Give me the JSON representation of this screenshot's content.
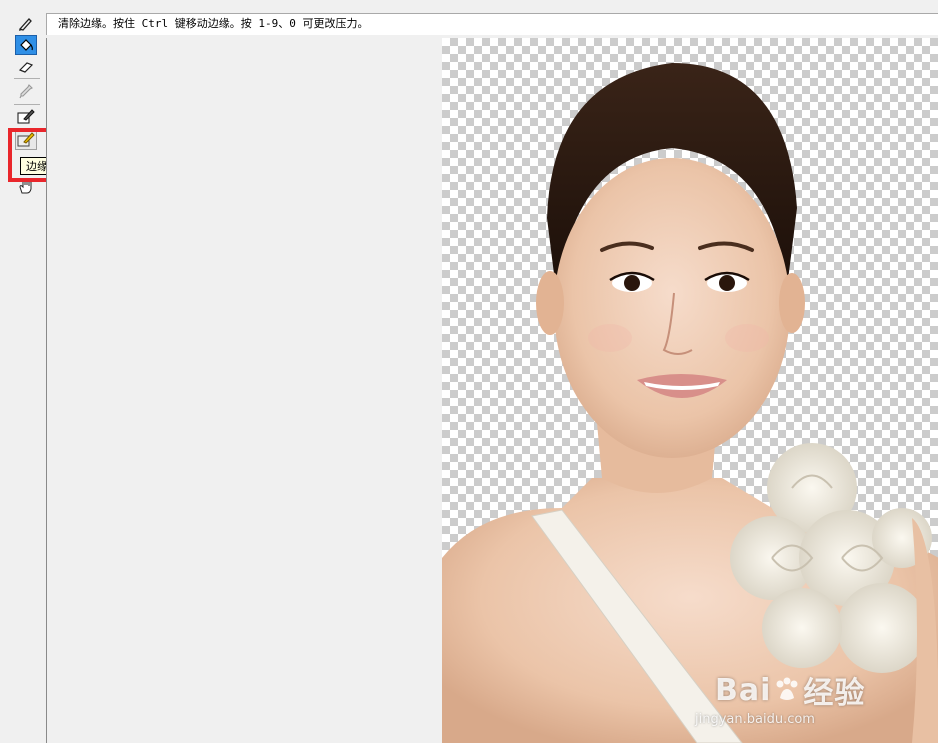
{
  "hint_bar": {
    "text": "清除边缘。按住 Ctrl 键移动边缘。按 1-9、0 可更改压力。"
  },
  "toolbar": {
    "tools": [
      {
        "name": "edge-highlighter-tool",
        "icon": "highlighter-icon",
        "state": "normal"
      },
      {
        "name": "fill-tool",
        "icon": "paint-bucket-icon",
        "state": "active"
      },
      {
        "name": "eraser-tool",
        "icon": "eraser-icon",
        "state": "normal"
      },
      {
        "name": "eyedropper-tool",
        "icon": "eyedropper-icon",
        "state": "disabled"
      },
      {
        "name": "cleanup-tool",
        "icon": "cleanup-brush-icon",
        "state": "normal"
      },
      {
        "name": "edge-touchup-tool",
        "icon": "touchup-brush-icon",
        "state": "hovered"
      },
      {
        "name": "hand-tool",
        "icon": "hand-icon",
        "state": "normal"
      }
    ],
    "tooltip": "边缘修饰工具 (T)"
  },
  "annotation": {
    "color": "#e9262b"
  },
  "watermark": {
    "brand_left": "Bai",
    "brand_right": "经验",
    "url": "jingyan.baidu.com"
  },
  "colors": {
    "active_tool": "#2f8fe6",
    "tooltip_bg": "#ffffe1",
    "checker_dark": "#cccccc",
    "checker_light": "#ffffff"
  }
}
